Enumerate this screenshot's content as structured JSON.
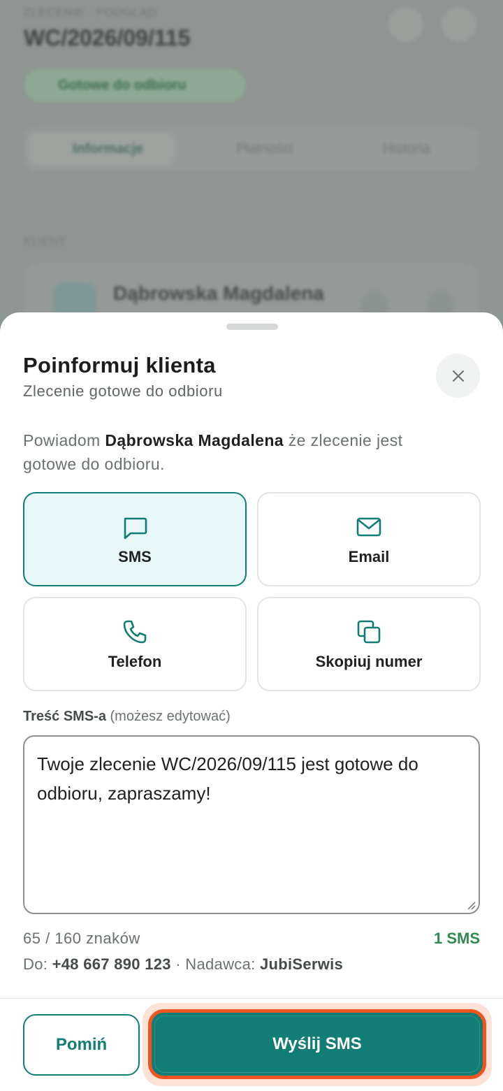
{
  "background": {
    "breadcrumb": "ZLECENIE · PODGLĄD",
    "order_number": "WC/2026/09/115",
    "status_chip": "Gotowe do odbioru",
    "tabs": [
      "Informacje",
      "Płatności",
      "Historia"
    ],
    "section_label": "KLIENT",
    "client_name": "Dąbrowska Magdalena"
  },
  "sheet": {
    "title": "Poinformuj klienta",
    "subtitle": "Zlecenie gotowe do odbioru",
    "intro_prefix": "Powiadom ",
    "client_name": "Dąbrowska Magdalena",
    "intro_suffix": " że zlecenie jest gotowe do odbioru.",
    "options": [
      {
        "label": "SMS",
        "icon": "message-icon",
        "selected": true
      },
      {
        "label": "Email",
        "icon": "mail-icon",
        "selected": false
      },
      {
        "label": "Telefon",
        "icon": "phone-icon",
        "selected": false
      },
      {
        "label": "Skopiuj numer",
        "icon": "copy-icon",
        "selected": false
      }
    ],
    "field_label_bold": "Treść SMS-a",
    "field_label_hint": " (możesz edytować)",
    "sms_text": "Twoje zlecenie WC/2026/09/115 jest gotowe do odbioru, zapraszamy!",
    "char_counter": "65 / 160 znaków",
    "sms_parts": "1 SMS",
    "to_label": "Do: ",
    "phone": "+48 667 890 123",
    "sender_label": " · Nadawca: ",
    "sender": "JubiSerwis",
    "skip_label": "Pomiń",
    "send_label": "Wyślij SMS"
  },
  "colors": {
    "accent": "#127d74",
    "selected_bg": "#e8f8f8",
    "highlight": "#f0541f",
    "sms_count": "#2f8a4f"
  }
}
